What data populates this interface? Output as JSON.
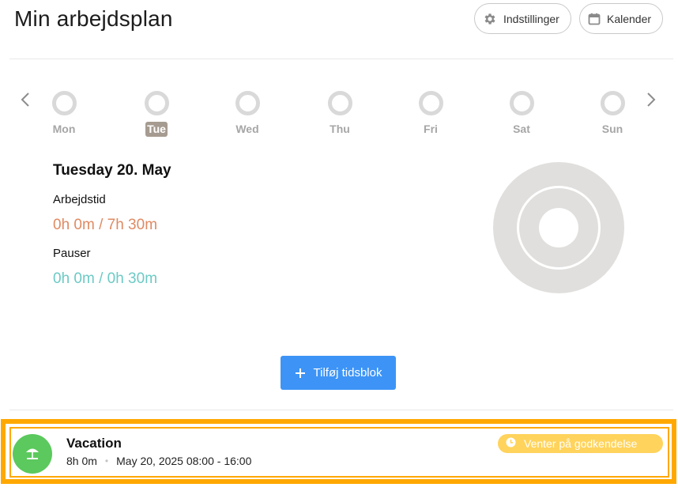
{
  "header": {
    "title": "Min arbejdsplan",
    "settings_label": "Indstillinger",
    "settings_icon": "gear-icon",
    "calendar_label": "Kalender",
    "calendar_icon": "calendar-icon"
  },
  "week": {
    "days": [
      {
        "label": "Mon",
        "active": false
      },
      {
        "label": "Tue",
        "active": true
      },
      {
        "label": "Wed",
        "active": false
      },
      {
        "label": "Thu",
        "active": false
      },
      {
        "label": "Fri",
        "active": false
      },
      {
        "label": "Sat",
        "active": false
      },
      {
        "label": "Sun",
        "active": false
      }
    ],
    "prev_icon": "chevron-left-icon",
    "next_icon": "chevron-right-icon"
  },
  "day_detail": {
    "heading": "Tuesday 20. May",
    "work_label": "Arbejdstid",
    "work_value": "0h 0m / 7h 30m",
    "break_label": "Pauser",
    "break_value": "0h 0m / 0h 30m"
  },
  "actions": {
    "add_block_label": "Tilføj tidsblok"
  },
  "entry": {
    "title": "Vacation",
    "duration": "8h 0m",
    "separator": "•",
    "range": "May 20, 2025 08:00 - 16:00",
    "status": "Venter på godkendelse",
    "icon": "beach-umbrella-icon",
    "status_icon": "clock-icon"
  },
  "colors": {
    "accent_blue": "#3d94f6",
    "work_orange": "#e08a62",
    "break_teal": "#6ccac5",
    "highlight_orange": "#ffa800",
    "badge_yellow": "#ffd35c",
    "vacation_green": "#5bc95d",
    "active_day_bg": "#a69b90"
  }
}
